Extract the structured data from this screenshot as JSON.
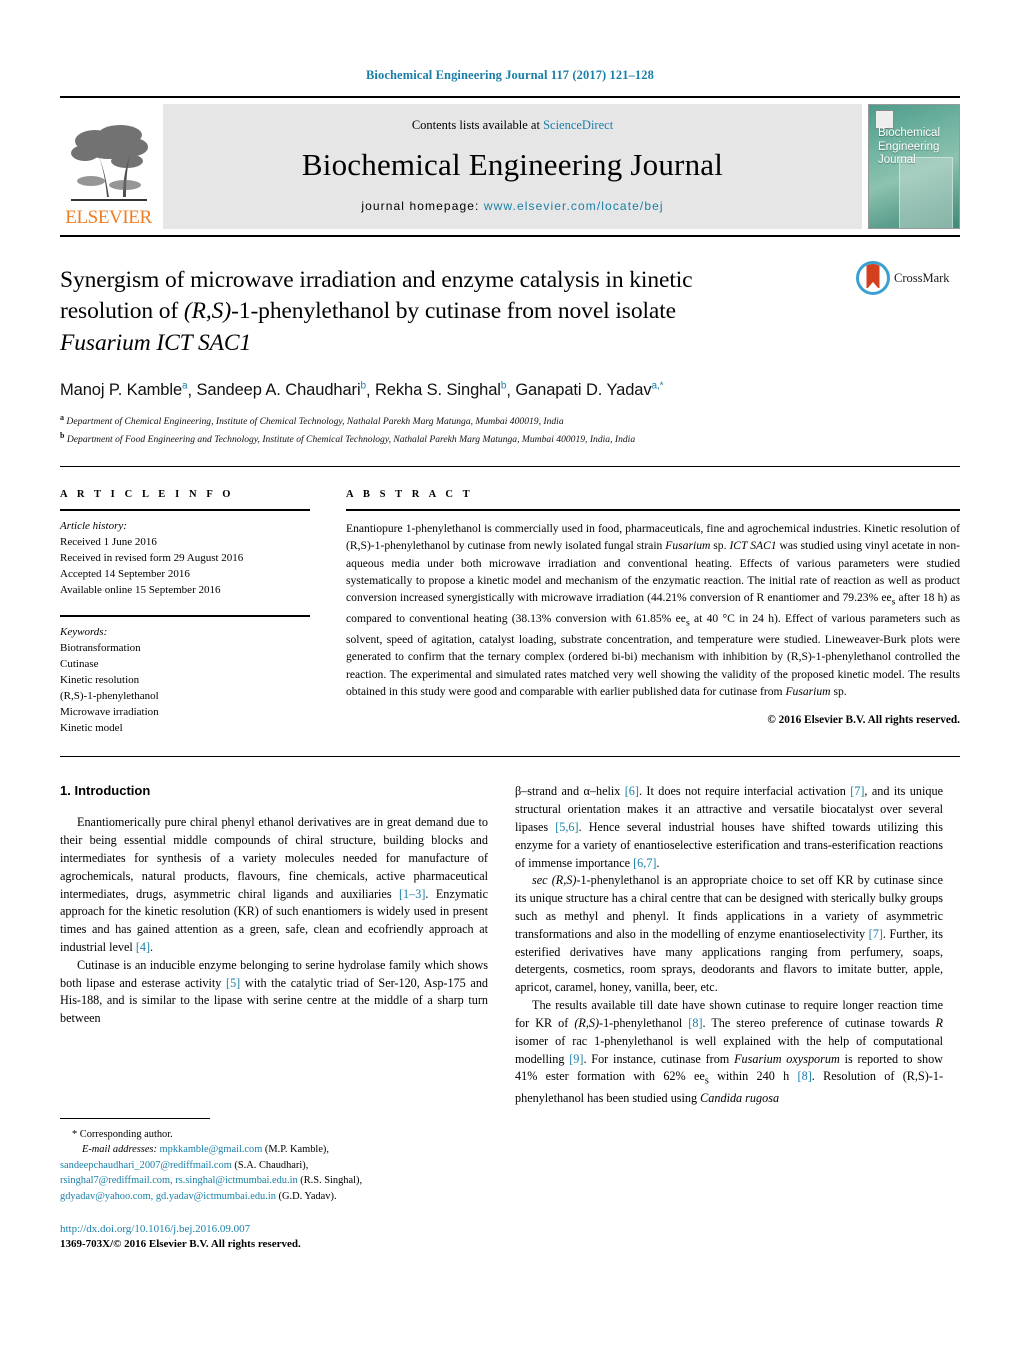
{
  "running_head": "Biochemical Engineering Journal 117 (2017) 121–128",
  "masthead": {
    "elsevier_wordmark": "ELSEVIER",
    "contents_prefix": "Contents lists available at ",
    "contents_link": "ScienceDirect",
    "journal_title": "Biochemical Engineering Journal",
    "homepage_prefix": "journal homepage: ",
    "homepage_url": "www.elsevier.com/locate/bej",
    "cover_title_line1": "Biochemical",
    "cover_title_line2": "Engineering",
    "cover_title_line3": "Journal"
  },
  "title": {
    "line1": "Synergism of microwave irradiation and enzyme catalysis in kinetic",
    "line2_a": "resolution of ",
    "line2_italic": "(R,S)",
    "line2_b": "-1-phenylethanol by cutinase from novel isolate",
    "line3_italic": "Fusarium ICT SAC1"
  },
  "crossmark_label": "CrossMark",
  "authors": {
    "list": [
      {
        "name": "Manoj P. Kamble",
        "sup": "a"
      },
      {
        "name": "Sandeep A. Chaudhari",
        "sup": "b"
      },
      {
        "name": "Rekha S. Singhal",
        "sup": "b"
      },
      {
        "name": "Ganapati D. Yadav",
        "sup": "a,*"
      }
    ],
    "affiliations": [
      {
        "marker": "a",
        "text": "Department of Chemical Engineering, Institute of Chemical Technology, Nathalal Parekh Marg Matunga, Mumbai 400019, India"
      },
      {
        "marker": "b",
        "text": "Department of Food Engineering and Technology, Institute of Chemical Technology, Nathalal Parekh Marg Matunga, Mumbai 400019, India, India"
      }
    ]
  },
  "article_info": {
    "heading": "A R T I C L E   I N F O",
    "history_label": "Article history:",
    "history": [
      "Received 1 June 2016",
      "Received in revised form 29 August 2016",
      "Accepted 14 September 2016",
      "Available online 15 September 2016"
    ],
    "keywords_label": "Keywords:",
    "keywords": [
      "Biotransformation",
      "Cutinase",
      "Kinetic resolution",
      "(R,S)-1-phenylethanol",
      "Microwave irradiation",
      "Kinetic model"
    ]
  },
  "abstract": {
    "heading": "A B S T R A C T",
    "p1_a": "Enantiopure 1-phenylethanol is commercially used in food, pharmaceuticals, fine and agrochemical industries. Kinetic resolution of (R,S)-1-phenylethanol by cutinase from newly isolated fungal strain ",
    "p1_italic1": "Fusarium",
    "p1_b": " sp. ",
    "p1_italic2": "ICT SAC1",
    "p1_c": " was studied using vinyl acetate in non-aqueous media under both microwave irradiation and conventional heating. Effects of various parameters were studied systematically to propose a kinetic model and mechanism of the enzymatic reaction. The initial rate of reaction as well as product conversion increased synergistically with microwave irradiation (44.21% conversion of R enantiomer and 79.23% ee",
    "p1_sub1": "s",
    "p1_d": " after 18 h) as compared to conventional heating (38.13% conversion with 61.85% ee",
    "p1_sub2": "s",
    "p1_e": " at 40 °C in 24 h). Effect of various parameters such as solvent, speed of agitation, catalyst loading, substrate concentration, and temperature were studied. Lineweaver-Burk plots were generated to confirm that the ternary complex (ordered bi-bi) mechanism with inhibition by (R,S)-1-phenylethanol controlled the reaction. The experimental and simulated rates matched very well showing the validity of the proposed kinetic model. The results obtained in this study were good and comparable with earlier published data for cutinase from ",
    "p1_italic3": "Fusarium",
    "p1_f": " sp.",
    "copyright": "© 2016 Elsevier B.V. All rights reserved."
  },
  "intro": {
    "heading": "1.  Introduction",
    "left_p1_a": "Enantiomerically pure chiral phenyl ethanol derivatives are in great demand due to their being essential middle compounds of chiral structure, building blocks and intermediates for synthesis of a variety molecules needed for manufacture of agrochemicals, natural products, flavours, fine chemicals, active pharmaceutical intermediates, drugs, asymmetric chiral ligands and auxiliaries ",
    "left_p1_ref1": "[1–3]",
    "left_p1_b": ". Enzymatic approach for the kinetic resolution (KR) of such enantiomers is widely used in present times and has gained attention as a green, safe, clean and ecofriendly approach at industrial level ",
    "left_p1_ref2": "[4]",
    "left_p1_c": ".",
    "left_p2_a": "Cutinase is an inducible enzyme belonging to serine hydrolase family which shows both lipase and esterase activity ",
    "left_p2_ref1": "[5]",
    "left_p2_b": " with the catalytic triad of Ser-120, Asp-175 and His-188, and is similar to the lipase with serine centre at the middle of a sharp turn between",
    "right_p1_a": "β–strand and α–helix ",
    "right_p1_ref1": "[6]",
    "right_p1_b": ". It does not require interfacial activation ",
    "right_p1_ref2": "[7]",
    "right_p1_c": ", and its unique structural orientation makes it an attractive and versatile biocatalyst over several lipases ",
    "right_p1_ref3": "[5,6]",
    "right_p1_d": ". Hence several industrial houses have shifted towards utilizing this enzyme for a variety of enantioselective esterification and trans-esterification reactions of immense importance ",
    "right_p1_ref4": "[6,7]",
    "right_p1_e": ".",
    "right_p2_a": "sec ",
    "right_p2_italic1": "(R,S)",
    "right_p2_b": "-1-phenylethanol is an appropriate choice to set off KR by cutinase since its unique structure has a chiral centre that can be designed with sterically bulky groups such as methyl and phenyl. It finds applications in a variety of asymmetric transformations and also in the modelling of enzyme enantioselectivity ",
    "right_p2_ref1": "[7]",
    "right_p2_c": ". Further, its esterified derivatives have many applications ranging from perfumery, soaps, detergents, cosmetics, room sprays, deodorants and flavors to imitate butter, apple, apricot, caramel, honey, vanilla, beer, etc.",
    "right_p3_a": "The results available till date have shown cutinase to require longer reaction time for KR of ",
    "right_p3_italic1": "(R,S)",
    "right_p3_b": "-1-phenylethanol ",
    "right_p3_ref1": "[8]",
    "right_p3_c": ". The stereo preference of cutinase towards ",
    "right_p3_italic2": "R",
    "right_p3_d": " isomer of rac 1-phenylethanol is well explained with the help of computational modelling ",
    "right_p3_ref2": "[9]",
    "right_p3_e": ". For instance, cutinase from ",
    "right_p3_italic3": "Fusarium oxysporum",
    "right_p3_f": " is reported to show 41% ester formation with 62% ee",
    "right_p3_sub": "s",
    "right_p3_g": " within 240 h ",
    "right_p3_ref3": "[8]",
    "right_p3_h": ". Resolution of (R,S)-1-phenylethanol has been studied using ",
    "right_p3_italic4": "Candida rugosa"
  },
  "footnote": {
    "corresponding": "*  Corresponding author.",
    "email_label": "E-mail addresses:",
    "emails": [
      {
        "addr": "mpkkamble@gmail.com",
        "who": " (M.P. Kamble),"
      },
      {
        "addr": "sandeepchaudhari_2007@rediffmail.com",
        "who": " (S.A. Chaudhari),"
      },
      {
        "addr": "rsinghal7@rediffmail.com, rs.singhal@ictmumbai.edu.in",
        "who": " (R.S. Singhal),"
      },
      {
        "addr": "gdyadav@yahoo.com, gd.yadav@ictmumbai.edu.in",
        "who": " (G.D. Yadav)."
      }
    ],
    "doi_url": "http://dx.doi.org/10.1016/j.bej.2016.09.007",
    "issn_line": "1369-703X/© 2016 Elsevier B.V. All rights reserved."
  },
  "colors": {
    "link_blue": "#1a7fa8",
    "elsevier_orange": "#ef7d22",
    "crossmark_blue": "#3aa0d1",
    "crossmark_red": "#d2401e"
  }
}
